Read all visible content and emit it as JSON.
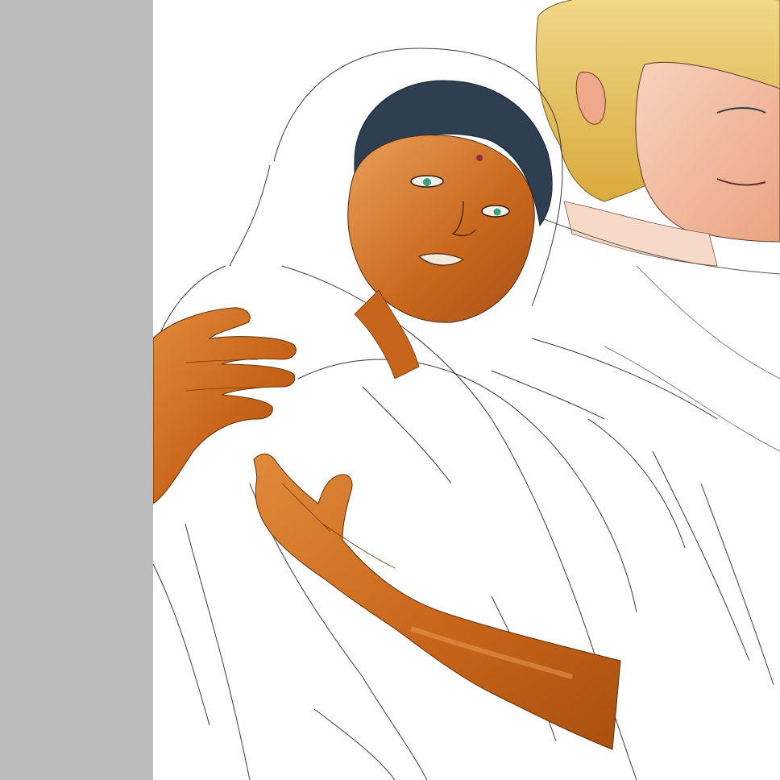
{
  "colors": {
    "side_panel": "#bcbcbc",
    "canvas": "#ffffff",
    "skin_dark": "#c9651a",
    "skin_mid": "#d9792c",
    "skin_light": "#e9a05a",
    "hair_dark": "#2f3f52",
    "hair_blond": "#e8c462",
    "skin_pale": "#f3b99a",
    "eye": "#3aa07a",
    "bindi": "#9a2b3a",
    "line": "#3a3a3a"
  }
}
